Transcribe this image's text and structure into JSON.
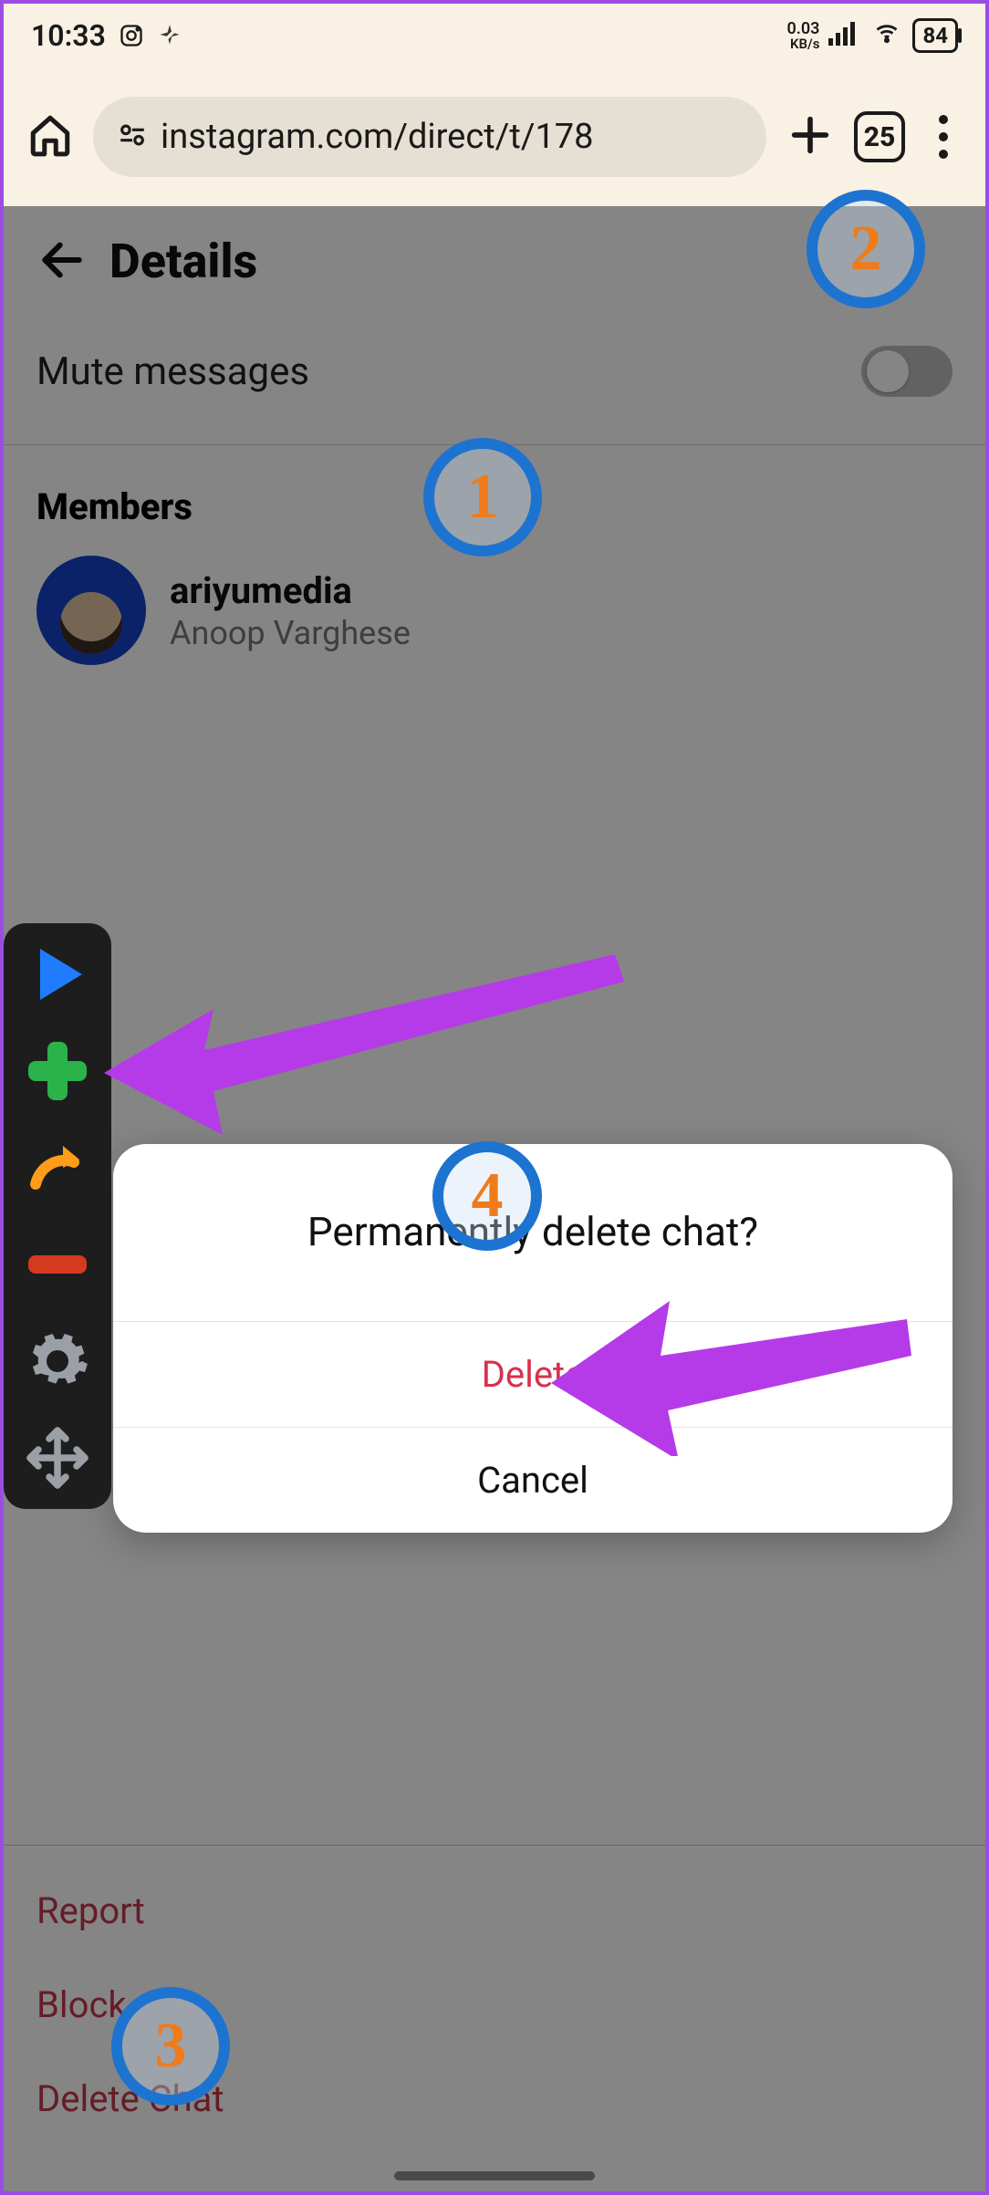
{
  "status_bar": {
    "time": "10:33",
    "network_rate": "0.03",
    "network_rate_unit": "KB/s",
    "battery_pct": "84"
  },
  "browser": {
    "url": "instagram.com/direct/t/178",
    "tab_count": "25"
  },
  "page": {
    "title": "Details",
    "mute_label": "Mute messages",
    "members_heading": "Members",
    "member_username": "ariyumedia",
    "member_fullname": "Anoop Varghese",
    "actions": {
      "report": "Report",
      "block": "Block",
      "delete_chat": "Delete Chat"
    }
  },
  "modal": {
    "title": "Permanently delete chat?",
    "delete": "Delete",
    "cancel": "Cancel"
  },
  "annotations": {
    "m1": "1",
    "m2": "2",
    "m3": "3",
    "m4": "4"
  }
}
